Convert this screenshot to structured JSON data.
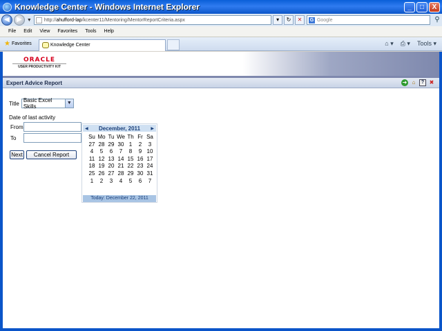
{
  "window": {
    "title": "Knowledge Center - Windows Internet Explorer",
    "minimize": "_",
    "maximize": "□",
    "close": "X"
  },
  "address": {
    "url_prefix": "http://",
    "url_host": "ahufford-lap",
    "url_path": "/kcenter11/Mentoring/MentorReportCriteria.aspx",
    "search_placeholder": "Google",
    "refresh": "↻",
    "stop": "✕"
  },
  "menu": [
    "File",
    "Edit",
    "View",
    "Favorites",
    "Tools",
    "Help"
  ],
  "tabs": {
    "favorites_label": "Favorites",
    "active_tab": "Knowledge Center",
    "tools_label": "Tools"
  },
  "branding": {
    "logo_text": "ORACLE",
    "logo_sub": "USER PRODUCTIVITY KIT"
  },
  "report": {
    "header_title": "Expert Advice Report",
    "title_label": "Title",
    "title_value": "Basic Excel Skills",
    "date_label": "Date of last activity",
    "from_label": "From",
    "to_label": "To",
    "from_value": "",
    "to_value": "",
    "next_button": "Next",
    "cancel_button": "Cancel Report"
  },
  "calendar": {
    "month_label": "December, 2011",
    "weekdays": [
      "Su",
      "Mo",
      "Tu",
      "We",
      "Th",
      "Fr",
      "Sa"
    ],
    "weeks": [
      [
        "27",
        "28",
        "29",
        "30",
        "1",
        "2",
        "3"
      ],
      [
        "4",
        "5",
        "6",
        "7",
        "8",
        "9",
        "10"
      ],
      [
        "11",
        "12",
        "13",
        "14",
        "15",
        "16",
        "17"
      ],
      [
        "18",
        "19",
        "20",
        "21",
        "22",
        "23",
        "24"
      ],
      [
        "25",
        "26",
        "27",
        "28",
        "29",
        "30",
        "31"
      ],
      [
        "1",
        "2",
        "3",
        "4",
        "5",
        "6",
        "7"
      ]
    ],
    "today_label": "Today: December 22, 2011"
  },
  "colors": {
    "titlebar": "#0b55c9",
    "oracle_red": "#d6001c",
    "calendar_header": "#cfe0f2",
    "calendar_today": "#a8c4e4"
  }
}
